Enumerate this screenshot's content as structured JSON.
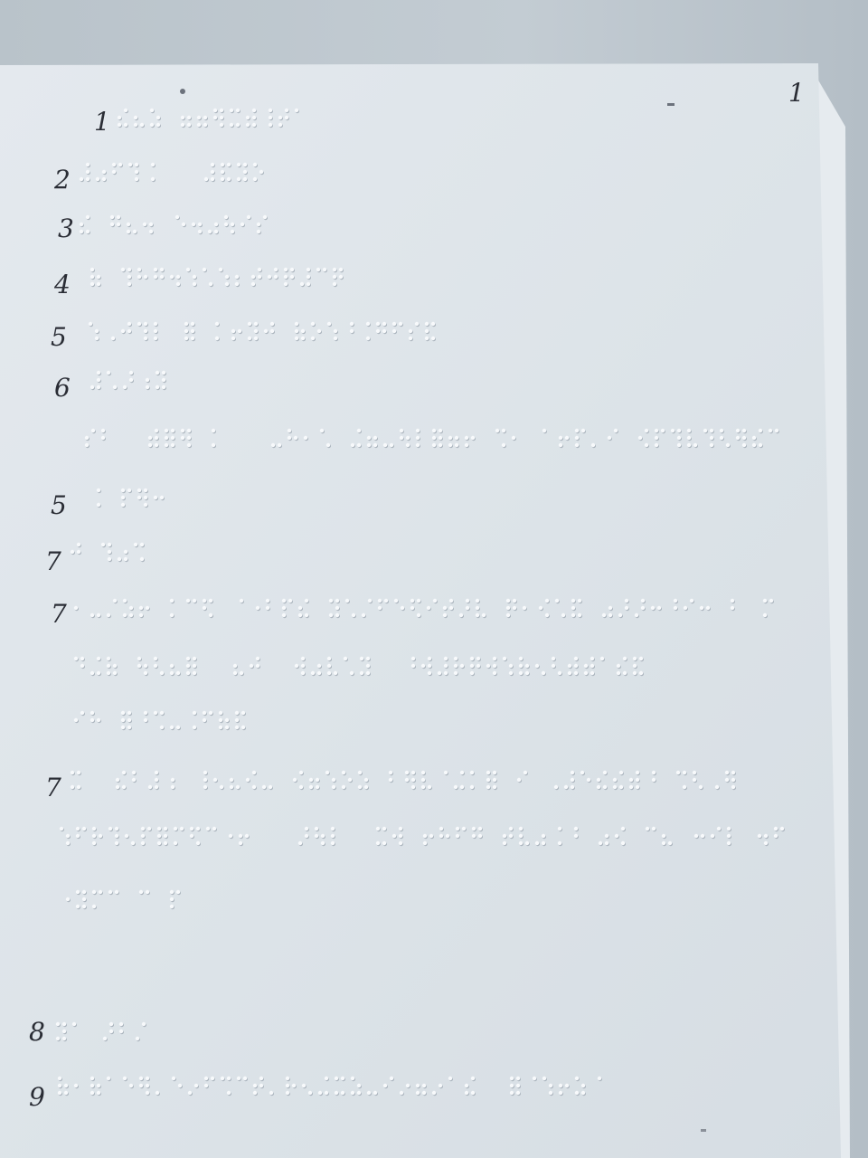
{
  "page_number": "1",
  "line_labels": [
    "1",
    "2",
    "3",
    "4",
    "5",
    "6",
    "5",
    "7",
    "7",
    "7",
    "8",
    "9"
  ],
  "colors": {
    "paper": "#dfe5ea",
    "paper_edge": "#e8edf1",
    "ink": "#2a2d35",
    "dot": "#f7f9fb",
    "dot_shadow": "#a9b3bc"
  }
}
